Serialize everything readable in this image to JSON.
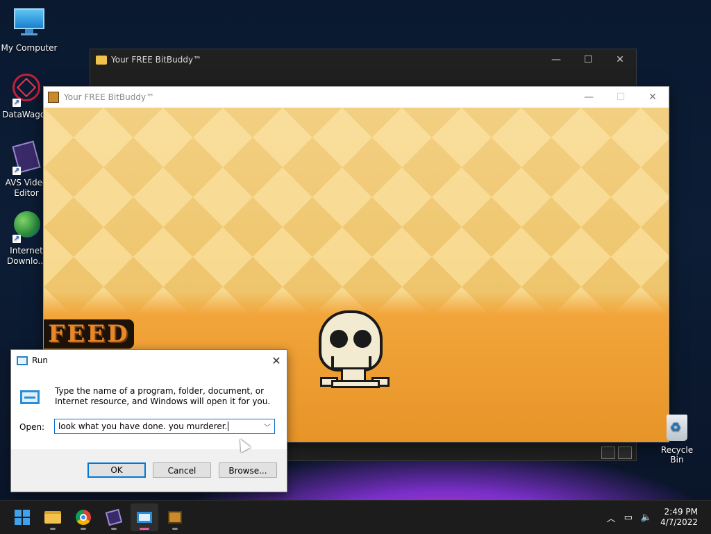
{
  "desktop": {
    "icons": [
      {
        "label": "My Computer"
      },
      {
        "label": "DataWagon"
      },
      {
        "label": "AVS Video Editor"
      },
      {
        "label": "Internet Downlo..."
      }
    ],
    "recycle_bin": "Recycle Bin"
  },
  "explorer": {
    "title": "Your FREE BitBuddy™"
  },
  "bitbuddy": {
    "title": "Your FREE BitBuddy™",
    "feed_label": "FEED"
  },
  "run_dialog": {
    "title": "Run",
    "description": "Type the name of a program, folder, document, or Internet resource, and Windows will open it for you.",
    "open_label": "Open:",
    "open_value": "look what you have done. you murderer.",
    "ok_label": "OK",
    "cancel_label": "Cancel",
    "browse_label": "Browse..."
  },
  "taskbar": {
    "items": [
      "windows-start",
      "file-explorer",
      "chrome",
      "avs-video-editor",
      "run",
      "bitbuddy"
    ],
    "time": "2:49 PM",
    "date": "4/7/2022"
  },
  "colors": {
    "accent": "#0078d7",
    "active_indicator": "#e05fa0"
  }
}
